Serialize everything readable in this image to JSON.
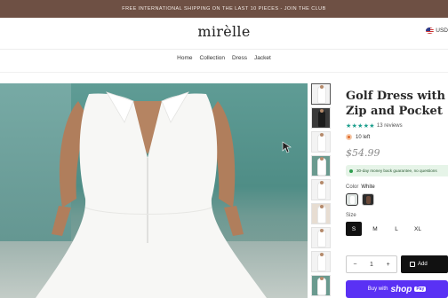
{
  "announcement": "FREE INTERNATIONAL SHIPPING ON THE LAST 10 PIECES - JOIN THE CLUB",
  "brand": "mirèlle",
  "currency": "USD",
  "nav": [
    "Home",
    "Collection",
    "Dress",
    "Jacket"
  ],
  "product": {
    "title": "Golf Dress with Zip and Pocket",
    "stars": "★★★★★",
    "reviews": "13 reviews",
    "stock": "10 left",
    "price": "$54.99",
    "guarantee": "30-day money back guarantee, no questions",
    "color_label": "Color",
    "color_value": "White",
    "size_label": "Size",
    "sizes": [
      "S",
      "M",
      "L",
      "XL"
    ],
    "selected_size": "S",
    "quantity": "1",
    "qty_minus": "−",
    "qty_plus": "+",
    "add_label": "Add",
    "shoppay_prefix": "Buy with",
    "shoppay_brand": "shop",
    "shoppay_pay": "Pay"
  },
  "colors": {
    "announcement_bg": "#6e5044",
    "shoppay": "#5a31f4",
    "stars": "#1b9e8c"
  },
  "icons": [
    "us-flag-icon",
    "star-icon",
    "fire-icon",
    "checkmark-dot-icon",
    "bag-icon",
    "mouse-cursor-icon"
  ]
}
